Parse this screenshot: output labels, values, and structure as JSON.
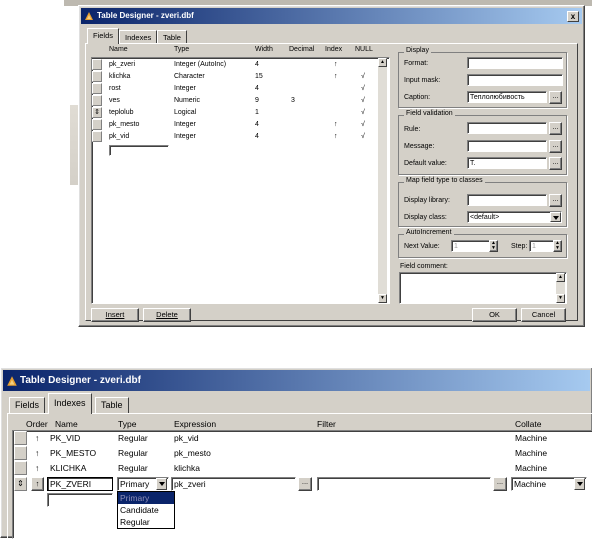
{
  "top_window": {
    "title": "Table Designer - zveri.dbf",
    "close_label": "x",
    "tabs": [
      {
        "label": "Fields"
      },
      {
        "label": "Indexes"
      },
      {
        "label": "Table"
      }
    ],
    "columns": {
      "name": "Name",
      "type": "Type",
      "width": "Width",
      "decimal": "Decimal",
      "index": "Index",
      "null": "NULL"
    },
    "rows": [
      {
        "name": "pk_zveri",
        "type": "Integer (AutoInc)",
        "width": "4",
        "decimal": "",
        "index": "↑",
        "null": ""
      },
      {
        "name": "klichka",
        "type": "Character",
        "width": "15",
        "decimal": "",
        "index": "↑",
        "null": "√"
      },
      {
        "name": "rost",
        "type": "Integer",
        "width": "4",
        "decimal": "",
        "index": "",
        "null": "√"
      },
      {
        "name": "ves",
        "type": "Numeric",
        "width": "9",
        "decimal": "3",
        "index": "",
        "null": "√"
      },
      {
        "name": "teplolub",
        "type": "Logical",
        "width": "1",
        "decimal": "",
        "index": "",
        "null": "√"
      },
      {
        "name": "pk_mesto",
        "type": "Integer",
        "width": "4",
        "decimal": "",
        "index": "↑",
        "null": "√"
      },
      {
        "name": "pk_vid",
        "type": "Integer",
        "width": "4",
        "decimal": "",
        "index": "↑",
        "null": "√"
      }
    ],
    "current_row_marker": "⇕",
    "display_group": "Display",
    "format_label": "Format:",
    "input_mask_label": "Input mask:",
    "caption_label": "Caption:",
    "caption_value": "Теплолюбивость",
    "validation_group": "Field validation",
    "rule_label": "Rule:",
    "message_label": "Message:",
    "default_label": "Default value:",
    "default_value": "T.",
    "map_group": "Map field type to classes",
    "display_library_label": "Display library:",
    "display_class_label": "Display class:",
    "display_class_value": "<default>",
    "autoinc_group": "AutoIncrement",
    "next_value_label": "Next Value:",
    "next_value": "1",
    "step_label": "Step:",
    "step_value": "1",
    "comment_label": "Field comment:",
    "ellipsis": "...",
    "insert_button": "Insert",
    "delete_button": "Delete",
    "ok_button": "OK",
    "cancel_button": "Cancel"
  },
  "bottom_window": {
    "title": "Table Designer - zveri.dbf",
    "tabs": [
      {
        "label": "Fields"
      },
      {
        "label": "Indexes"
      },
      {
        "label": "Table"
      }
    ],
    "columns": {
      "order": "Order",
      "name": "Name",
      "type": "Type",
      "expression": "Expression",
      "filter": "Filter",
      "collate": "Collate"
    },
    "rows": [
      {
        "order": "↑",
        "name": "PK_VID",
        "type": "Regular",
        "expression": "pk_vid",
        "collate": "Machine"
      },
      {
        "order": "↑",
        "name": "PK_MESTO",
        "type": "Regular",
        "expression": "pk_mesto",
        "collate": "Machine"
      },
      {
        "order": "↑",
        "name": "KLICHKA",
        "type": "Regular",
        "expression": "klichka",
        "collate": "Machine"
      }
    ],
    "edit_row": {
      "marker": "⇕",
      "order": "↑",
      "name": "PK_ZVERI",
      "type": "Primary",
      "expression": "pk_zveri",
      "filter": "",
      "collate": "Machine"
    },
    "type_options": [
      "Primary",
      "Candidate",
      "Regular"
    ],
    "ellipsis": "..."
  },
  "colors": {
    "title_start": "#0a246a",
    "title_end": "#a6caf0",
    "face": "#d4d0c8",
    "highlight": "#0a246a"
  }
}
